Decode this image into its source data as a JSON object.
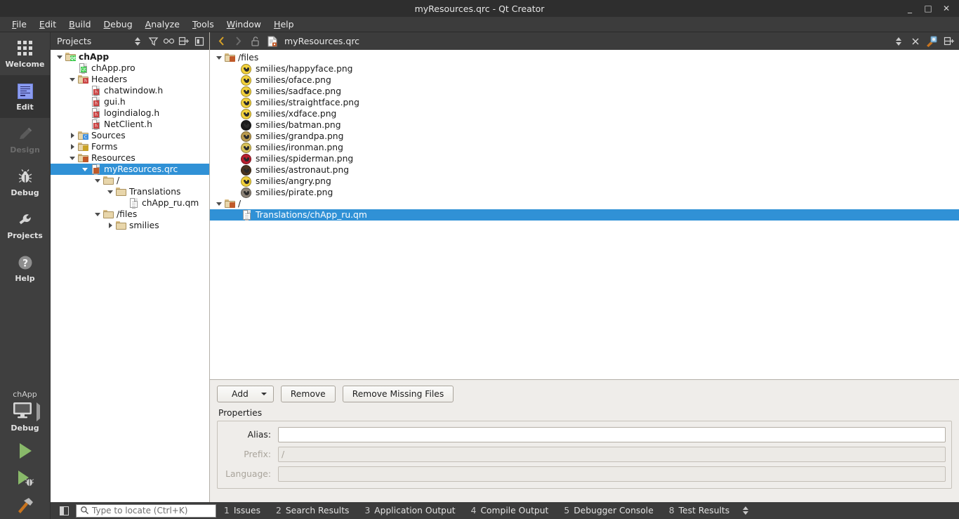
{
  "window": {
    "title": "myResources.qrc - Qt Creator",
    "minimize": "_",
    "maximize": "□",
    "close": "✕"
  },
  "menubar": {
    "items": [
      {
        "label": "File",
        "accel": "F",
        "rest": "ile"
      },
      {
        "label": "Edit",
        "accel": "E",
        "rest": "dit"
      },
      {
        "label": "Build",
        "accel": "B",
        "rest": "uild"
      },
      {
        "label": "Debug",
        "accel": "D",
        "rest": "ebug"
      },
      {
        "label": "Analyze",
        "accel": "A",
        "rest": "nalyze"
      },
      {
        "label": "Tools",
        "accel": "T",
        "rest": "ools"
      },
      {
        "label": "Window",
        "accel": "W",
        "rest": "indow"
      },
      {
        "label": "Help",
        "accel": "H",
        "rest": "elp"
      }
    ]
  },
  "modebar": {
    "modes": [
      {
        "label": "Welcome",
        "icon": "grid-icon",
        "selected": false,
        "disabled": false
      },
      {
        "label": "Edit",
        "icon": "document-icon",
        "selected": true,
        "disabled": false
      },
      {
        "label": "Design",
        "icon": "pencil-icon",
        "selected": false,
        "disabled": true
      },
      {
        "label": "Debug",
        "icon": "bug-icon",
        "selected": false,
        "disabled": false
      },
      {
        "label": "Projects",
        "icon": "wrench-icon",
        "selected": false,
        "disabled": false
      },
      {
        "label": "Help",
        "icon": "question-icon",
        "selected": false,
        "disabled": false
      }
    ],
    "kit": {
      "project_name": "chApp",
      "build_config": "Debug",
      "target_icon": "monitor-icon",
      "run_label": "run-button",
      "debug_label": "start-debugging-button",
      "build_label": "build-project-button"
    }
  },
  "projects_panel": {
    "title": "Projects",
    "toolbar_icons": [
      "filter-icon",
      "link-icon",
      "split-icon",
      "collapse-icon"
    ],
    "tree": [
      {
        "label": "chApp",
        "depth": 0,
        "arrow": "down",
        "icon": "folder-qt",
        "bold": true,
        "selected": false
      },
      {
        "label": "chApp.pro",
        "depth": 1,
        "arrow": "none",
        "icon": "file-qt",
        "bold": false,
        "selected": false
      },
      {
        "label": "Headers",
        "depth": 1,
        "arrow": "down",
        "icon": "folder-h",
        "bold": false,
        "selected": false
      },
      {
        "label": "chatwindow.h",
        "depth": 2,
        "arrow": "none",
        "icon": "file-h",
        "bold": false,
        "selected": false
      },
      {
        "label": "gui.h",
        "depth": 2,
        "arrow": "none",
        "icon": "file-h",
        "bold": false,
        "selected": false
      },
      {
        "label": "logindialog.h",
        "depth": 2,
        "arrow": "none",
        "icon": "file-h",
        "bold": false,
        "selected": false
      },
      {
        "label": "NetClient.h",
        "depth": 2,
        "arrow": "none",
        "icon": "file-h",
        "bold": false,
        "selected": false
      },
      {
        "label": "Sources",
        "depth": 1,
        "arrow": "right",
        "icon": "folder-cpp",
        "bold": false,
        "selected": false
      },
      {
        "label": "Forms",
        "depth": 1,
        "arrow": "right",
        "icon": "folder-forms",
        "bold": false,
        "selected": false
      },
      {
        "label": "Resources",
        "depth": 1,
        "arrow": "down",
        "icon": "folder-res",
        "bold": false,
        "selected": false
      },
      {
        "label": "myResources.qrc",
        "depth": 2,
        "arrow": "down",
        "icon": "file-res",
        "bold": false,
        "selected": true
      },
      {
        "label": "/",
        "depth": 3,
        "arrow": "down",
        "icon": "folder-plain",
        "bold": false,
        "selected": false
      },
      {
        "label": "Translations",
        "depth": 4,
        "arrow": "down",
        "icon": "folder-plain",
        "bold": false,
        "selected": false
      },
      {
        "label": "chApp_ru.qm",
        "depth": 5,
        "arrow": "none",
        "icon": "file-plain",
        "bold": false,
        "selected": false
      },
      {
        "label": "/files",
        "depth": 3,
        "arrow": "down",
        "icon": "folder-plain",
        "bold": false,
        "selected": false
      },
      {
        "label": "smilies",
        "depth": 4,
        "arrow": "right",
        "icon": "folder-plain",
        "bold": false,
        "selected": false
      }
    ]
  },
  "editor": {
    "toolbar": {
      "back_icon": "back-arrow-icon",
      "forward_icon": "forward-arrow-icon",
      "lock_icon": "unlocked-icon",
      "file_icon": "qrc-file-icon",
      "filename": "myResources.qrc",
      "dropdown_icon": "updown-arrows-icon",
      "close_icon": "close-icon",
      "split_editor_icon": "split-editor-icon",
      "extra_icon": "editor-options-icon"
    },
    "resource_tree": [
      {
        "label": "/files",
        "type": "prefix",
        "icon": "resource-folder-icon",
        "selected": false
      },
      {
        "label": "smilies/happyface.png",
        "type": "file",
        "icon": "smiley-happy",
        "color": "#f2d13c",
        "selected": false
      },
      {
        "label": "smilies/oface.png",
        "type": "file",
        "icon": "smiley-o",
        "color": "#f2d13c",
        "selected": false
      },
      {
        "label": "smilies/sadface.png",
        "type": "file",
        "icon": "smiley-sad",
        "color": "#f2d13c",
        "selected": false
      },
      {
        "label": "smilies/straightface.png",
        "type": "file",
        "icon": "smiley-straight",
        "color": "#f2d13c",
        "selected": false
      },
      {
        "label": "smilies/xdface.png",
        "type": "file",
        "icon": "smiley-xd",
        "color": "#f2d13c",
        "selected": false
      },
      {
        "label": "smilies/batman.png",
        "type": "file",
        "icon": "smiley-batman",
        "color": "#1c1c1c",
        "selected": false
      },
      {
        "label": "smilies/grandpa.png",
        "type": "file",
        "icon": "smiley-grandpa",
        "color": "#b99a4e",
        "selected": false
      },
      {
        "label": "smilies/ironman.png",
        "type": "file",
        "icon": "smiley-ironman",
        "color": "#d8c25a",
        "selected": false
      },
      {
        "label": "smilies/spiderman.png",
        "type": "file",
        "icon": "smiley-spiderman",
        "color": "#b81f2e",
        "selected": false
      },
      {
        "label": "smilies/astronaut.png",
        "type": "file",
        "icon": "smiley-astronaut",
        "color": "#4a3520",
        "selected": false
      },
      {
        "label": "smilies/angry.png",
        "type": "file",
        "icon": "smiley-angry",
        "color": "#f2d13c",
        "selected": false
      },
      {
        "label": "smilies/pirate.png",
        "type": "file",
        "icon": "smiley-pirate",
        "color": "#8d8377",
        "selected": false
      },
      {
        "label": "/",
        "type": "prefix",
        "icon": "resource-folder-icon",
        "selected": false
      },
      {
        "label": "Translations/chApp_ru.qm",
        "type": "file",
        "icon": "qm-file-icon",
        "color": "#eeeeee",
        "selected": true
      }
    ]
  },
  "properties_pane": {
    "buttons": {
      "add": "Add",
      "add_has_dropdown": true,
      "remove": "Remove",
      "remove_missing": "Remove Missing Files"
    },
    "section_label": "Properties",
    "fields": [
      {
        "label": "Alias:",
        "value": "",
        "placeholder": "",
        "disabled": false
      },
      {
        "label": "Prefix:",
        "value": "/",
        "placeholder": "",
        "disabled": true
      },
      {
        "label": "Language:",
        "value": "",
        "placeholder": "",
        "disabled": true
      }
    ]
  },
  "statusbar": {
    "toggle_icon": "toggle-sidebar-icon",
    "locator": {
      "icon": "search-icon",
      "placeholder": "Type to locate (Ctrl+K)",
      "value": ""
    },
    "panes": [
      {
        "num": "1",
        "name": "Issues"
      },
      {
        "num": "2",
        "name": "Search Results"
      },
      {
        "num": "3",
        "name": "Application Output"
      },
      {
        "num": "4",
        "name": "Compile Output"
      },
      {
        "num": "5",
        "name": "Debugger Console"
      },
      {
        "num": "8",
        "name": "Test Results"
      }
    ],
    "arrows_icon": "updown-arrows-icon"
  },
  "colors": {
    "selection_blue": "#3091d6",
    "chrome_dark": "#3c3c3c",
    "titlebar": "#2e2e2e",
    "panel_bg": "#efedea"
  }
}
